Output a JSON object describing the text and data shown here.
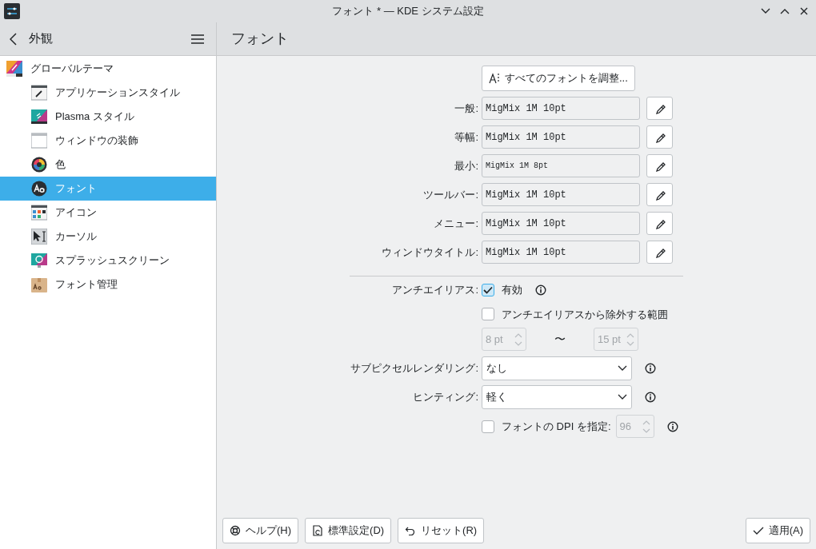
{
  "window": {
    "title": "フォント * — KDE システム設定"
  },
  "sidebar": {
    "title": "外観",
    "items": [
      {
        "label": "グローバルテーマ",
        "selected": false,
        "children": [
          {
            "label": "アプリケーションスタイル",
            "selected": false
          },
          {
            "label": "Plasma スタイル",
            "selected": false
          },
          {
            "label": "ウィンドウの装飾",
            "selected": false
          },
          {
            "label": "色",
            "selected": false
          },
          {
            "label": "フォント",
            "selected": true
          },
          {
            "label": "アイコン",
            "selected": false
          },
          {
            "label": "カーソル",
            "selected": false
          },
          {
            "label": "スプラッシュスクリーン",
            "selected": false
          },
          {
            "label": "フォント管理",
            "selected": false
          }
        ]
      }
    ]
  },
  "page": {
    "title": "フォント",
    "adjust_all_button": "すべてのフォントを調整...",
    "fonts": [
      {
        "label": "一般:",
        "value": "MigMix 1M 10pt"
      },
      {
        "label": "等幅:",
        "value": "MigMix 1M 10pt"
      },
      {
        "label": "最小:",
        "value": "MigMix 1M 8pt"
      },
      {
        "label": "ツールバー:",
        "value": "MigMix 1M 10pt"
      },
      {
        "label": "メニュー:",
        "value": "MigMix 1M 10pt"
      },
      {
        "label": "ウィンドウタイトル:",
        "value": "MigMix 1M 10pt"
      }
    ],
    "antialiasing": {
      "label": "アンチエイリアス:",
      "checkbox": "有効",
      "checked": true
    },
    "exclude": {
      "checkbox": "アンチエイリアスから除外する範囲",
      "checked": false,
      "from": "8 pt",
      "separator": "〜",
      "to": "15 pt"
    },
    "subpixel": {
      "label": "サブピクセルレンダリング:",
      "value": "なし"
    },
    "hinting": {
      "label": "ヒンティング:",
      "value": "軽く"
    },
    "dpi": {
      "checkbox": "フォントの DPI を指定:",
      "checked": false,
      "value": "96"
    }
  },
  "footer": {
    "buttons": [
      "ヘルプ(H)",
      "標準設定(D)",
      "リセット(R)"
    ],
    "apply": "適用(A)"
  }
}
